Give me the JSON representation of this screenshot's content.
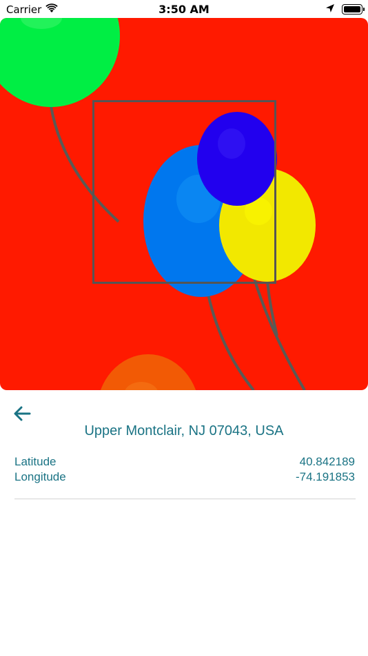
{
  "status_bar": {
    "carrier": "Carrier",
    "time": "3:50 AM",
    "icons": [
      "wifi-icon",
      "location-arrow-icon",
      "battery-icon"
    ]
  },
  "photo": {
    "description_icon": "balloon-photo",
    "background_color": "#ff1a00",
    "balloon_colors": [
      "#00ee44",
      "#0077ee",
      "#2200ee",
      "#f2e800",
      "#f25a05"
    ],
    "frame_color": "#555555"
  },
  "detail": {
    "back_icon": "arrow-left-icon",
    "address": "Upper Montclair, NJ 07043, USA",
    "latitude_label": "Latitude",
    "latitude_value": "40.842189",
    "longitude_label": "Longitude",
    "longitude_value": "-74.191853",
    "accent_color": "#1a7384"
  }
}
